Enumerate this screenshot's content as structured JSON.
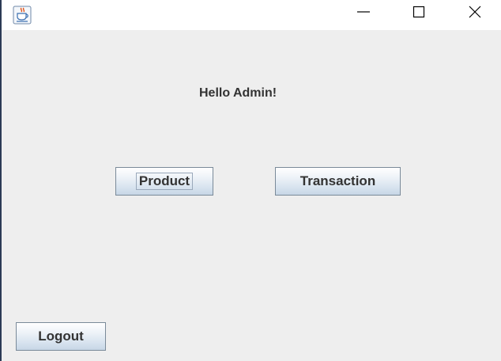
{
  "window": {
    "icon": "java-coffee-cup-icon",
    "controls": {
      "minimize_icon": "minimize-icon",
      "maximize_icon": "maximize-icon",
      "close_icon": "close-icon"
    }
  },
  "main": {
    "greeting": "Hello Admin!",
    "product_label": "Product",
    "transaction_label": "Transaction",
    "logout_label": "Logout"
  },
  "colors": {
    "background": "#eeeeee",
    "titlebar": "#ffffff",
    "button_border": "#7a8a99",
    "text": "#333333"
  }
}
